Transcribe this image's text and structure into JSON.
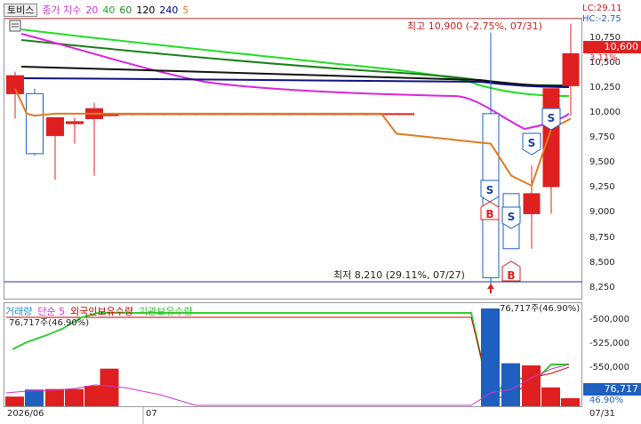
{
  "toolbar": {
    "stock_button": "토비스",
    "ma_legend": [
      {
        "label": "종가 지수",
        "color": "#cc33cc"
      },
      {
        "label": "20",
        "color": "#cc33cc"
      },
      {
        "label": "40",
        "color": "#22aa22"
      },
      {
        "label": "60",
        "color": "#228822"
      },
      {
        "label": "120",
        "color": "#000000"
      },
      {
        "label": "240",
        "color": "#000088"
      },
      {
        "label": "5",
        "color": "#e07b20"
      }
    ]
  },
  "price_panel": {
    "high_annotation": "최고 10,900 (-2.75%, 07/31)",
    "low_annotation": "최저 8,210 (29.11%, 07/27)",
    "lc_label": "LC:29.11",
    "hc_label": "HC:-2.75",
    "current_price": "10,600",
    "current_change": "3.11%",
    "y_ticks": [
      "10,750",
      "10,500",
      "10,250",
      "10,000",
      "9,750",
      "9,500",
      "9,250",
      "9,000",
      "8,750",
      "8,500",
      "8,250"
    ],
    "signals": [
      "S",
      "B",
      "S",
      "S",
      "S",
      "B"
    ]
  },
  "volume_panel": {
    "legend": [
      {
        "label": "거래량",
        "color": "#1e90d0"
      },
      {
        "label": "단순 5",
        "color": "#cc33cc"
      },
      {
        "label": "외국인보유수량",
        "color": "#cc0000"
      },
      {
        "label": "기관보유수량",
        "color": "#22cc22"
      }
    ],
    "left_annotation": "76,717주(46.90%)",
    "right_annotation": "76,717주(46.90%)",
    "y_ticks": [
      "-500,000",
      "-525,000",
      "-550,000"
    ],
    "current_volume": "76,717",
    "current_pct": "46.90%"
  },
  "x_axis": {
    "left": "2026/06",
    "mid": "07",
    "right": "07/31"
  },
  "colors": {
    "up": "#e02020",
    "down": "#1f5fc0",
    "border": "#999999"
  },
  "chart_data": {
    "type": "candlestick",
    "ylim": [
      8150,
      10950
    ],
    "candles": [
      {
        "o": 10200,
        "h": 10420,
        "l": 9950,
        "c": 10380
      },
      {
        "o": 10200,
        "h": 10250,
        "l": 9580,
        "c": 9600
      },
      {
        "o": 9780,
        "h": 9960,
        "l": 9340,
        "c": 9960
      },
      {
        "o": 9900,
        "h": 9960,
        "l": 9700,
        "c": 9920
      },
      {
        "o": 9950,
        "h": 10110,
        "l": 9380,
        "c": 10050
      },
      {
        "o": 9980,
        "h": 10000,
        "l": 9980,
        "c": 10000
      },
      {
        "o": 10000,
        "h": 10000,
        "l": 10000,
        "c": 10000
      },
      {
        "o": 10000,
        "h": 10000,
        "l": 10000,
        "c": 10000
      },
      {
        "o": 10000,
        "h": 10000,
        "l": 10000,
        "c": 10000
      },
      {
        "o": 10000,
        "h": 10000,
        "l": 10000,
        "c": 10000
      },
      {
        "o": 10000,
        "h": 10000,
        "l": 10000,
        "c": 10000
      },
      {
        "o": 10000,
        "h": 10000,
        "l": 10000,
        "c": 10000
      },
      {
        "o": 10000,
        "h": 10000,
        "l": 10000,
        "c": 10000
      },
      {
        "o": 10000,
        "h": 10000,
        "l": 10000,
        "c": 10000
      },
      {
        "o": 10000,
        "h": 10000,
        "l": 10000,
        "c": 10000
      },
      {
        "o": 10000,
        "h": 10000,
        "l": 10000,
        "c": 10000
      },
      {
        "o": 10000,
        "h": 10000,
        "l": 10000,
        "c": 10000
      },
      {
        "o": 10000,
        "h": 10000,
        "l": 10000,
        "c": 10000
      },
      {
        "o": 10000,
        "h": 10000,
        "l": 10000,
        "c": 10000
      },
      {
        "o": 10000,
        "h": 10000,
        "l": 10000,
        "c": 10000
      },
      {
        "o": 10000,
        "h": 10000,
        "l": 10000,
        "c": 10000
      },
      {
        "o": 10000,
        "h": 10000,
        "l": 10000,
        "c": 10000
      },
      {
        "o": 10000,
        "h": 10000,
        "l": 10000,
        "c": 10000
      },
      {
        "o": 10000,
        "h": 10000,
        "l": 10000,
        "c": 10000
      },
      {
        "o": 10000,
        "h": 10000,
        "l": 10000,
        "c": 10000
      },
      {
        "o": 10000,
        "h": 10810,
        "l": 8210,
        "c": 8360
      },
      {
        "o": 9200,
        "h": 9200,
        "l": 8650,
        "c": 8650
      },
      {
        "o": 9000,
        "h": 9480,
        "l": 8650,
        "c": 9200
      },
      {
        "o": 9270,
        "h": 10250,
        "l": 9000,
        "c": 10250
      },
      {
        "o": 10280,
        "h": 10900,
        "l": 9980,
        "c": 10600
      }
    ],
    "ma5": [
      10250,
      10000,
      9980,
      10000,
      10000,
      10000,
      10000,
      10000,
      10000,
      10000,
      10000,
      10000,
      10000,
      10000,
      10000,
      10000,
      10000,
      10000,
      10000,
      10000,
      10000,
      10000,
      10000,
      10000,
      10000,
      9800,
      9700,
      9380,
      9280,
      9850,
      9950
    ],
    "volume_ylim": [
      0,
      960000
    ],
    "volume": [
      90000,
      155000,
      160000,
      160000,
      190000,
      350000,
      0,
      0,
      0,
      0,
      0,
      0,
      0,
      0,
      0,
      0,
      0,
      0,
      0,
      0,
      0,
      0,
      0,
      0,
      0,
      910000,
      400000,
      380000,
      175000,
      75000
    ]
  }
}
